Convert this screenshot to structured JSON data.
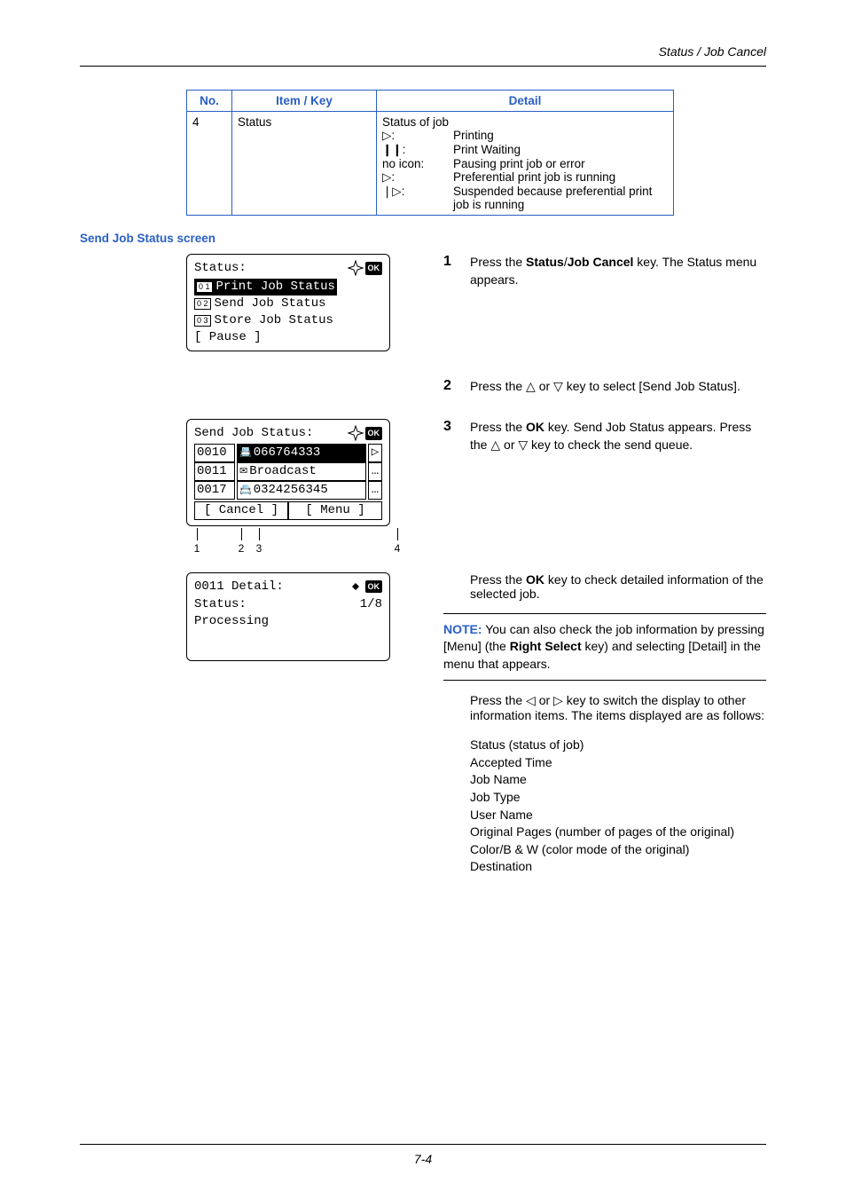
{
  "header": {
    "title": "Status / Job Cancel"
  },
  "table": {
    "headers": {
      "no": "No.",
      "item": "Item / Key",
      "detail": "Detail"
    },
    "row": {
      "no": "4",
      "item": "Status",
      "title": "Status of job",
      "icons": [
        "▷:",
        "❙❙:",
        "no icon:",
        "▷:",
        "❘▷:"
      ],
      "lines": [
        "Printing",
        "Print Waiting",
        "Pausing print job or error",
        "Preferential print job is running",
        "Suspended because preferential print job is running"
      ]
    }
  },
  "section": {
    "label": "Send Job Status screen"
  },
  "panels": {
    "status": {
      "title": "Status:",
      "ok": "OK",
      "items": [
        {
          "num": "0 1",
          "label": "Print Job Status",
          "selected": true
        },
        {
          "num": "0 2",
          "label": "Send Job Status"
        },
        {
          "num": "0 3",
          "label": "Store Job Status"
        }
      ],
      "softkey": "[ Pause  ]"
    },
    "send": {
      "title": "Send Job Status:",
      "ok": "OK",
      "rows": [
        {
          "id": "0010",
          "icon": "📇",
          "name": "066764333",
          "last": "▷",
          "inv": true
        },
        {
          "id": "0011",
          "icon": "✉",
          "name": "Broadcast",
          "last": "…"
        },
        {
          "id": "0017",
          "icon": "📇",
          "name": "0324256345",
          "last": "…"
        }
      ],
      "soft_left": "[ Cancel ]",
      "soft_right": "[  Menu  ]",
      "callouts": [
        "1",
        "2",
        "3",
        "4"
      ]
    },
    "detail": {
      "title": "0011 Detail:",
      "ok": "OK",
      "line1_label": "Status:",
      "line1_page": "1/8",
      "line2": "Processing"
    }
  },
  "steps": {
    "s1": {
      "num": "1",
      "pre": "Press the ",
      "b1": "Status",
      "slash": "/",
      "b2": "Job Cancel",
      "post": " key. The Status menu appears."
    },
    "s2": {
      "num": "2",
      "pre": "Press the ",
      "tri1": "△",
      "mid": " or ",
      "tri2": "▽",
      "post": " key to select [Send Job Status]."
    },
    "s3": {
      "num": "3",
      "pre": "Press the ",
      "b": "OK",
      "post1": " key. Send Job Status appears. Press the ",
      "tri1": "△",
      "mid": " or ",
      "tri2": "▽",
      "post2": " key to check the send queue."
    },
    "check_detail": {
      "pre": "Press the ",
      "b": "OK",
      "post": " key to check detailed information of the selected job."
    },
    "note": {
      "label": "NOTE:",
      "text1": " You can also check the job information by pressing [Menu] (the ",
      "b": "Right Select",
      "text2": " key) and selecting [Detail] in the menu that appears."
    },
    "switch": {
      "pre": "Press the ",
      "tri1": "◁",
      "mid": " or ",
      "tri2": "▷",
      "post": " key to switch the display to other information items. The items displayed are as follows:"
    },
    "items": [
      "Status (status of job)",
      "Accepted Time",
      "Job Name",
      "Job Type",
      "User Name",
      "Original Pages (number of pages of the original)",
      "Color/B & W (color mode of the original)",
      "Destination"
    ]
  },
  "footer": {
    "page": "7-4"
  }
}
